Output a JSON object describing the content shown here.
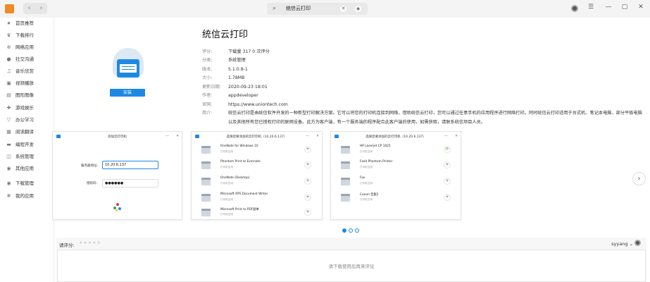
{
  "header": {
    "search_text": "统信云打印",
    "window_controls": [
      "☰",
      "—",
      "▢",
      "✕"
    ]
  },
  "sidebar": {
    "items": [
      {
        "label": "首页推荐",
        "icon": "star-icon",
        "glyph": "★"
      },
      {
        "label": "下载排行",
        "icon": "trophy-icon",
        "glyph": "♛"
      },
      {
        "label": "网络应用",
        "icon": "globe-icon",
        "glyph": "⊕"
      },
      {
        "label": "社交沟通",
        "icon": "chat-icon",
        "glyph": "●"
      },
      {
        "label": "音乐欣赏",
        "icon": "music-icon",
        "glyph": "♫"
      },
      {
        "label": "视频播放",
        "icon": "video-icon",
        "glyph": "▣"
      },
      {
        "label": "图形图像",
        "icon": "image-icon",
        "glyph": "▤"
      },
      {
        "label": "游戏娱乐",
        "icon": "gamepad-icon",
        "glyph": "✚"
      },
      {
        "label": "办公学习",
        "icon": "office-icon",
        "glyph": "▽"
      },
      {
        "label": "阅读翻译",
        "icon": "book-icon",
        "glyph": "▦"
      },
      {
        "label": "编程开发",
        "icon": "code-icon",
        "glyph": "▬"
      },
      {
        "label": "系统管理",
        "icon": "system-icon",
        "glyph": "◫"
      },
      {
        "label": "其他应用",
        "icon": "more-icon",
        "glyph": "◉"
      }
    ],
    "bottom_items": [
      {
        "label": "下载管理",
        "icon": "download-icon",
        "glyph": "◉"
      },
      {
        "label": "我的应用",
        "icon": "my-apps-icon",
        "glyph": "✻"
      }
    ]
  },
  "app": {
    "title": "统信云打印",
    "install_label": "安装",
    "fields": [
      {
        "key": "评分:",
        "value": "下载量 317    0 次评分"
      },
      {
        "key": "分类:",
        "value": "系统管理"
      },
      {
        "key": "版本:",
        "value": "5.1.0.8-1"
      },
      {
        "key": "大小:",
        "value": "1.78MB"
      },
      {
        "key": "更新日期:",
        "value": "2020-09-23 18:01"
      },
      {
        "key": "作者:",
        "value": "appdeveloper"
      },
      {
        "key": "官网:",
        "value": "https://www.uniontech.com"
      },
      {
        "key": "简介:",
        "value": ""
      }
    ],
    "description": [
      "统信云打印是由统信软件开发的一种新型打印解决方案。它可以将您的打印机连接到网络，借助统信云打印，您可以通过任意手机的应用程序进行网络打印。同时统信云打印适用于台式机、笔记本电脑、部分平板电脑",
      "以及其他所有您已授权打印的联网设备。此方为客户端，有一个服务端的程序配合此客户端的使用，如需获取，请联系统信项目人员。"
    ]
  },
  "screenshots": {
    "shot1": {
      "title": "添加云打印机",
      "server_label": "服务器地址:",
      "server_value": "10.20.6.137",
      "password_label": "授权码:",
      "password_value": "●●●●●●"
    },
    "shot2": {
      "title": "选择您要添加的云打印机（10.20.6.137）",
      "printers": [
        {
          "name": "OneNote for Windows 10",
          "status": "打印机空闲",
          "action": "+"
        },
        {
          "name": "Phantom Print to Evernote",
          "status": "打印机空闲",
          "action": "+"
        },
        {
          "name": "OneNote (Desktop)",
          "status": "打印机空闲",
          "action": "+"
        },
        {
          "name": "Microsoft XPS Document Writer",
          "status": "打印机空闲",
          "action": "+"
        },
        {
          "name": "Microsoft Print to PDF副本",
          "status": "打印机空闲",
          "action": "+"
        }
      ]
    },
    "shot3": {
      "title": "选择您要添加的云打印机（10.20.6.137）",
      "printers": [
        {
          "name": "HP Laserjet CP 1025",
          "status": "打印机空闲",
          "action": "⟳"
        },
        {
          "name": "Foxit Phantom Printer",
          "status": "打印机空闲",
          "action": "+"
        },
        {
          "name": "Fax",
          "status": "打印机空闲",
          "action": "+"
        },
        {
          "name": "Canon 佳能2",
          "status": "打印机空闲",
          "action": "+"
        }
      ]
    }
  },
  "rating": {
    "label": "请评分:",
    "stars": "★★★★★",
    "username": "syyang",
    "placeholder": "请下载使用后再来评论"
  },
  "colors": {
    "accent": "#1e88e5",
    "logo": "#f08a24"
  }
}
